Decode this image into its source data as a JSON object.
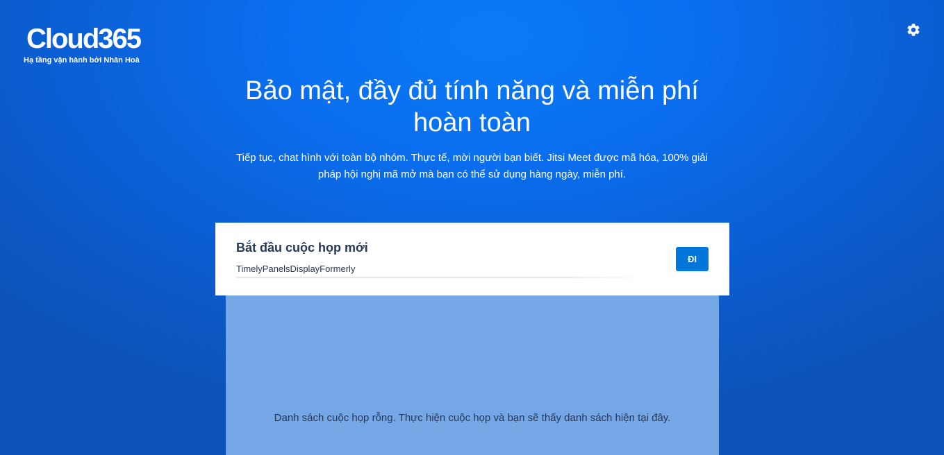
{
  "brand": {
    "name": "Cloud365",
    "tagline": "Hạ tầng vận hành bởi Nhân Hoà"
  },
  "header": {
    "settings_icon": "gear-icon"
  },
  "hero": {
    "title": "Bảo mật, đầy đủ tính năng và miễn phí hoàn toàn",
    "description": "Tiếp tục, chat hình với toàn bộ nhóm. Thực tế, mời người bạn biết. Jitsi Meet được mã hóa, 100% giải pháp hội nghị mã mở mà bạn có thể sử dụng hàng ngày, miễn phí."
  },
  "start_meeting": {
    "title": "Bắt đầu cuộc họp mới",
    "room_name_value": "TimelyPanelsDisplayFormerly",
    "go_label": "ĐI"
  },
  "meetings_list": {
    "empty_text": "Danh sách cuộc họp rỗng. Thực hiện cuộc họp và bạn sẽ thấy danh sách hiện tại đây."
  },
  "colors": {
    "background": "#0a6ff0",
    "accent_button": "#0376da",
    "panel": "#75a6e6",
    "text_dark": "#253858"
  }
}
